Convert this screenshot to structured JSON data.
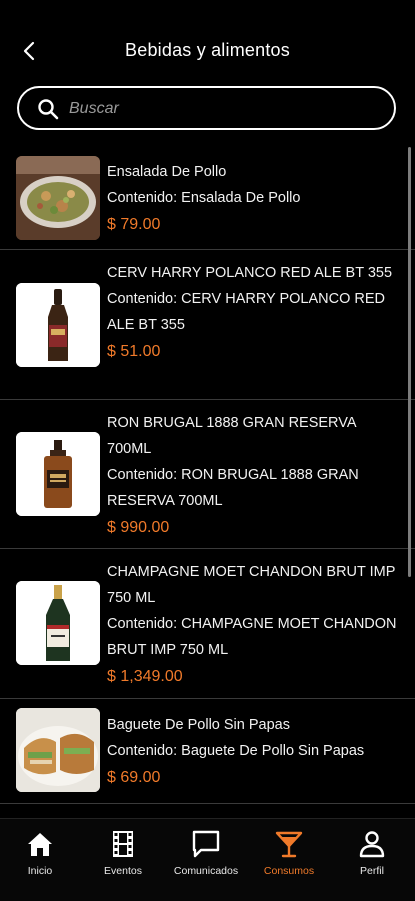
{
  "header": {
    "title": "Bebidas y alimentos",
    "back_icon": "chevron-left-icon"
  },
  "search": {
    "placeholder": "Buscar",
    "value": ""
  },
  "products": [
    {
      "name": "Ensalada De Pollo",
      "contenido": "Contenido: Ensalada De Pollo",
      "price": "$ 79.00",
      "image": "salad-photo"
    },
    {
      "name": "CERV HARRY POLANCO RED ALE BT 355",
      "contenido": "Contenido: CERV HARRY POLANCO RED ALE BT 355",
      "price": "$ 51.00",
      "image": "beer-bottle"
    },
    {
      "name": "RON BRUGAL 1888 GRAN RESERVA 700ML",
      "contenido": "Contenido: RON BRUGAL 1888 GRAN RESERVA 700ML",
      "price": "$ 990.00",
      "image": "rum-bottle"
    },
    {
      "name": "CHAMPAGNE MOET CHANDON BRUT IMP 750 ML",
      "contenido": "Contenido: CHAMPAGNE MOET CHANDON BRUT IMP 750 ML",
      "price": "$ 1,349.00",
      "image": "champagne-bottle"
    },
    {
      "name": "Baguete De Pollo Sin Papas",
      "contenido": "Contenido: Baguete De Pollo Sin Papas",
      "price": "$ 69.00",
      "image": "sandwich-photo"
    }
  ],
  "tabs": [
    {
      "label": "Inicio",
      "icon": "home-icon"
    },
    {
      "label": "Eventos",
      "icon": "film-icon"
    },
    {
      "label": "Comunicados",
      "icon": "chat-icon"
    },
    {
      "label": "Consumos",
      "icon": "cocktail-icon",
      "active": true
    },
    {
      "label": "Perfil",
      "icon": "person-icon"
    }
  ],
  "colors": {
    "accent": "#f07a2a",
    "background": "#000000"
  }
}
